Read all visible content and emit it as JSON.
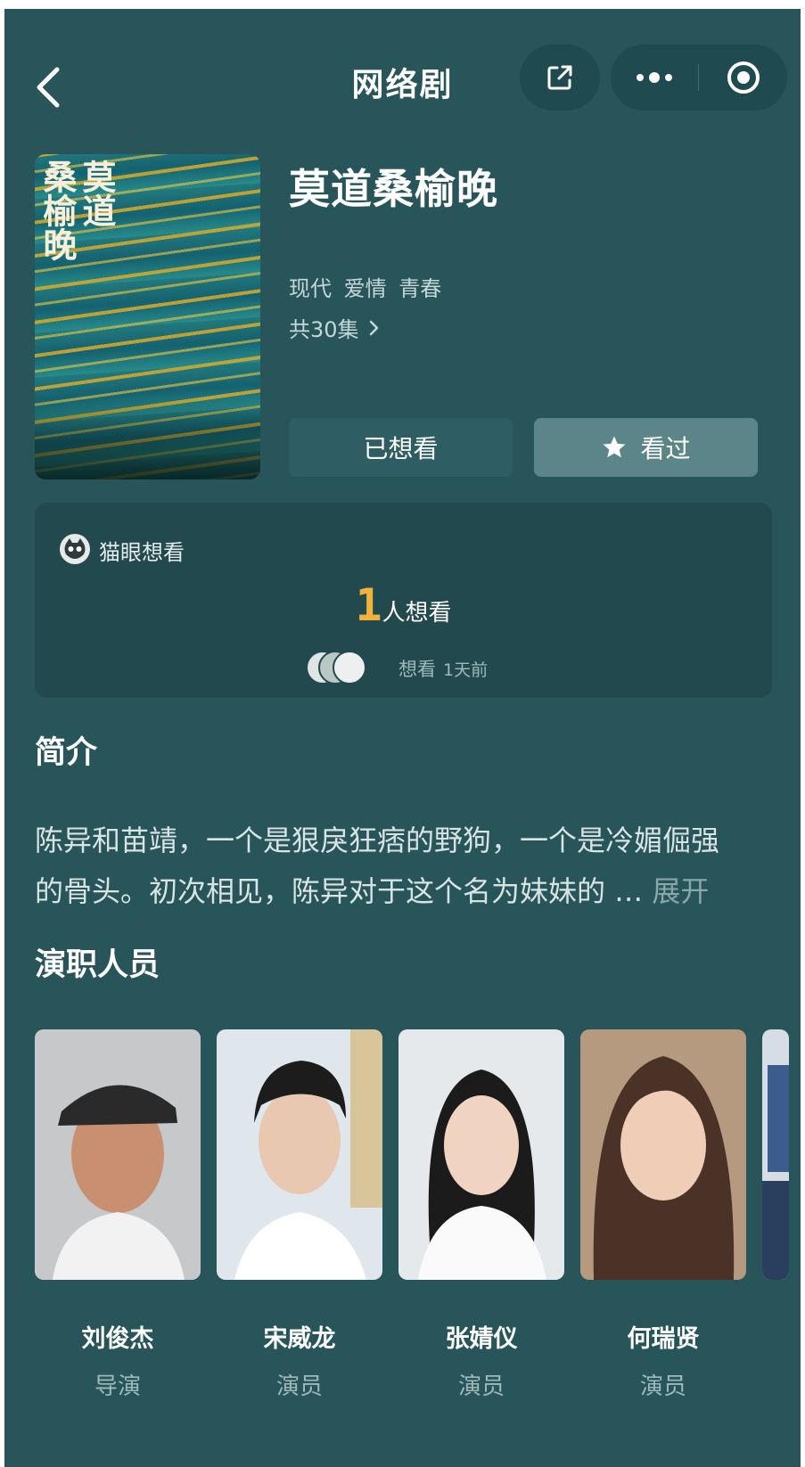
{
  "nav": {
    "title": "网络剧",
    "back_icon": "chevron-left-icon",
    "share_icon": "share-external-icon",
    "more_icon": "more-dots-icon",
    "target_icon": "target-icon"
  },
  "poster": {
    "title_col1": "莫道",
    "title_col2": "桑榆晚"
  },
  "show": {
    "title": "莫道桑榆晚",
    "tags": [
      "现代",
      "爱情",
      "青春"
    ],
    "episodes": "共30集",
    "wanted_button": "已想看",
    "watched_button": "看过",
    "star_icon": "star-icon"
  },
  "want_card": {
    "source_label": "猫眼想看",
    "count": "1",
    "count_unit": "人想看",
    "meta_label": "想看",
    "meta_time": "1天前"
  },
  "intro": {
    "title": "简介",
    "line1": "陈异和苗靖，一个是狠戾狂痞的野狗，一个是冷媚倔强",
    "line2": "的骨头。初次相见，陈异对于这个名为妹妹的 … ",
    "expand": "展开"
  },
  "cast": {
    "title": "演职人员",
    "members": [
      {
        "name": "刘俊杰",
        "role": "导演"
      },
      {
        "name": "宋威龙",
        "role": "演员"
      },
      {
        "name": "张婧仪",
        "role": "演员"
      },
      {
        "name": "何瑞贤",
        "role": "演员"
      }
    ]
  },
  "colors": {
    "background": "#27555a",
    "card": "#224a4e",
    "accent_count": "#f0b23a",
    "watched_button": "#5b8588"
  }
}
